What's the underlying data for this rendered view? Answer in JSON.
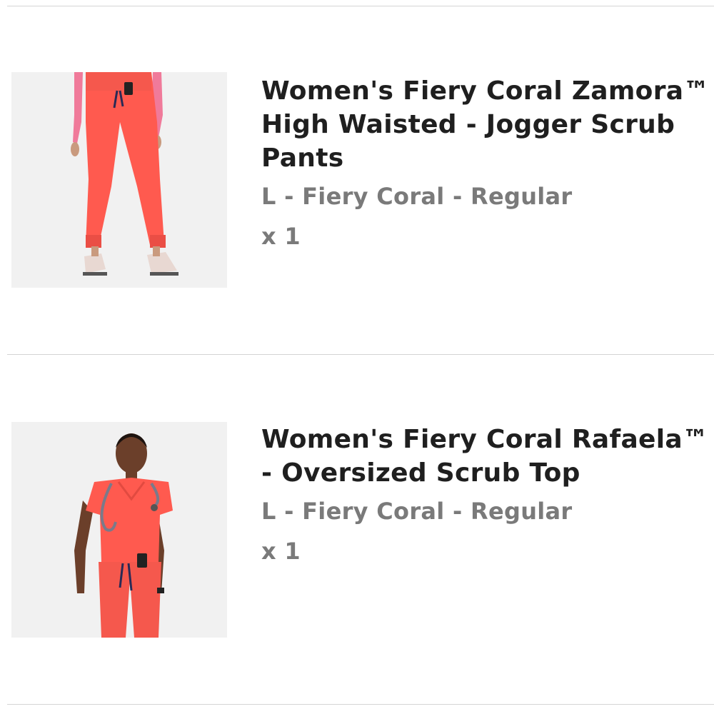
{
  "cart": {
    "items": [
      {
        "title": "Women's Fiery Coral Zamora™ High Waisted - Jogger Scrub Pants",
        "variant": "L - Fiery Coral - Regular",
        "quantity": "x 1",
        "image_icon": "jogger-pants-product-photo"
      },
      {
        "title": "Women's Fiery Coral Rafaela™ - Oversized Scrub Top",
        "variant": "L - Fiery Coral - Regular",
        "quantity": "x 1",
        "image_icon": "scrub-top-product-photo"
      }
    ]
  },
  "colors": {
    "product_coral": "#ff5a4f",
    "title_text": "#1f1f1f",
    "meta_text": "#7a7a7a",
    "divider": "#d4d4d4"
  }
}
